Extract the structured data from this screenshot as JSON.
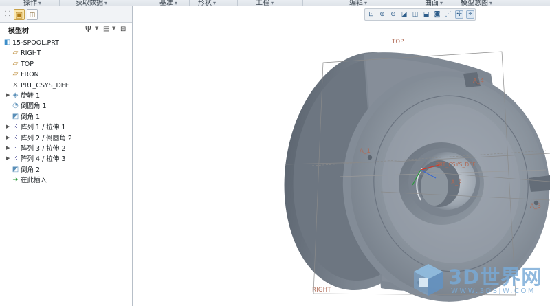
{
  "ribbon": {
    "groups": [
      "操作",
      "获取数据",
      "基准",
      "形状",
      "工程",
      "编辑",
      "曲面",
      "模型意图"
    ]
  },
  "left_panel": {
    "tabs": [
      {
        "icon": "model-tree-tab-icon",
        "active": false
      },
      {
        "icon": "folder-browser-icon",
        "active": true
      },
      {
        "icon": "favorites-icon",
        "active": false
      }
    ],
    "tree_title": "模型树",
    "settings_icon": "tree-settings-icon",
    "show_icon": "tree-show-icon",
    "columns_icon": "tree-columns-icon"
  },
  "tree": {
    "items": [
      {
        "label": "15-SPOOL.PRT",
        "icon": "part-icon",
        "expandable": false
      },
      {
        "label": "RIGHT",
        "icon": "datum-plane-icon",
        "expandable": false
      },
      {
        "label": "TOP",
        "icon": "datum-plane-icon",
        "expandable": false
      },
      {
        "label": "FRONT",
        "icon": "datum-plane-icon",
        "expandable": false
      },
      {
        "label": "PRT_CSYS_DEF",
        "icon": "coordinate-system-icon",
        "expandable": false
      },
      {
        "label": "旋转 1",
        "icon": "revolve-icon",
        "expandable": true
      },
      {
        "label": "倒圆角 1",
        "icon": "round-icon",
        "expandable": false
      },
      {
        "label": "倒角 1",
        "icon": "chamfer-icon",
        "expandable": false
      },
      {
        "label": "阵列 1 / 拉伸 1",
        "icon": "pattern-icon",
        "expandable": true
      },
      {
        "label": "阵列 2 / 倒圆角 2",
        "icon": "pattern-icon",
        "expandable": true
      },
      {
        "label": "阵列 3 / 拉伸 2",
        "icon": "pattern-icon",
        "expandable": true
      },
      {
        "label": "阵列 4 / 拉伸 3",
        "icon": "pattern-icon",
        "expandable": true
      },
      {
        "label": "倒角 2",
        "icon": "chamfer-icon",
        "expandable": false
      },
      {
        "label": "在此插入",
        "icon": "insert-here-arrow-icon",
        "expandable": false
      }
    ]
  },
  "view_toolbar": {
    "buttons": [
      "refit-icon",
      "zoom-in-icon",
      "zoom-out-icon",
      "repaint-icon",
      "view-manager-icon",
      "saved-orientations-icon",
      "display-style-icon",
      "datum-display-icon",
      "spin-center-icon",
      "annotation-display-icon"
    ]
  },
  "viewport": {
    "datum_labels": {
      "top": "TOP",
      "right": "RIGHT",
      "a1": "A_1",
      "a2": "A_2",
      "a3": "A_3",
      "a4": "A_4",
      "csys": "PRT_CSYS_DEF"
    },
    "model_color": "#7d8691"
  },
  "watermark": {
    "text": "3D世界网",
    "sub": "WWW.3DSJW.COM"
  }
}
